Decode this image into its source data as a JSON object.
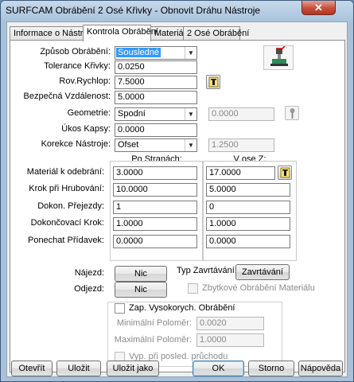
{
  "window": {
    "title": "SURFCAM Obrábění 2 Osé Křivky - Obnovit Dráhu Nástroje",
    "close_glyph": "✕"
  },
  "tabs": [
    "Informace o Nástroji",
    "Kontrola Obrábění",
    "Materiál",
    "2 Osé Obrábění"
  ],
  "active_tab": "Kontrola Obrábění",
  "form": {
    "machining_method": {
      "label": "Způsob Obrábění:",
      "value": "Sousledné"
    },
    "curve_tolerance": {
      "label": "Tolerance Křivky:",
      "value": "0.0250"
    },
    "rapid_plane": {
      "label": "Rov.Rychlop:",
      "value": "7.5000"
    },
    "safe_distance": {
      "label": "Bezpečná Vzdálenost:",
      "value": "5.0000"
    },
    "geometry": {
      "label": "Geometrie:",
      "value": "Spodní",
      "extra_value": "0.0000"
    },
    "pocket_draft": {
      "label": "Úkos Kapsy:",
      "value": "0.0000"
    },
    "tool_compensation": {
      "label": "Korekce Nástroje:",
      "value": "Ofset",
      "extra_value": "1.2500"
    }
  },
  "table": {
    "col_side": "Po Stranách:",
    "col_z": "V ose Z:",
    "rows": [
      {
        "label": "Materiál k odebrání:",
        "side": "3.0000",
        "z": "17.0000"
      },
      {
        "label": "Krok při Hrubování:",
        "side": "10.0000",
        "z": "5.0000"
      },
      {
        "label": "Dokon. Přejezdy:",
        "side": "1",
        "z": "0"
      },
      {
        "label": "Dokončovací Krok:",
        "side": "1.0000",
        "z": "1.0000"
      },
      {
        "label": "Ponechat Přídavek:",
        "side": "0.0000",
        "z": "0.0000"
      }
    ]
  },
  "entry": {
    "lead_in_label": "Nájezd:",
    "lead_in_value": "Nic",
    "lead_out_label": "Odjezd:",
    "lead_out_value": "Nic",
    "plunge_type_label": "Typ Zavrtávání:",
    "plunge_type_value": "Zavrtávání",
    "rest_machining_label": "Zbytkové Obrábění Materiálu"
  },
  "high_speed": {
    "checkbox_label": "Zap. Vysokorych. Obrábění",
    "min_radius_label": "Minimální Poloměr:",
    "min_radius_value": "0.0020",
    "max_radius_label": "Maximální Poloměr:",
    "max_radius_value": "1.0000",
    "last_pass_label": "Vyp. při posled. průchodu"
  },
  "buttons": {
    "open": "Otevřít",
    "save": "Uložit",
    "save_as": "Uložit jako",
    "ok": "OK",
    "cancel": "Storno",
    "help": "Nápověda"
  },
  "icons": {
    "tool_preview": "tool-preview-icon",
    "pick": "pick-icon",
    "pin": "pin-icon"
  },
  "colors": {
    "selection": "#3399ff",
    "frame": "#a9c0d8",
    "close": "#c74f3a"
  }
}
